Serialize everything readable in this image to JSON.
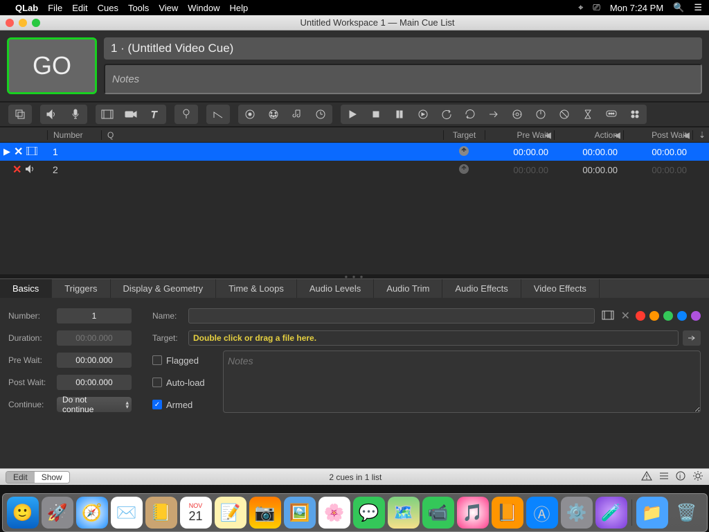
{
  "menubar": {
    "app": "QLab",
    "items": [
      "File",
      "Edit",
      "Cues",
      "Tools",
      "View",
      "Window",
      "Help"
    ],
    "clock": "Mon 7:24 PM"
  },
  "window": {
    "title": "Untitled Workspace 1 — Main Cue List"
  },
  "header": {
    "go": "GO",
    "cue_title": "1 · (Untitled Video Cue)",
    "notes_placeholder": "Notes"
  },
  "columns": {
    "number": "Number",
    "q": "Q",
    "target": "Target",
    "prewait": "Pre Wait",
    "action": "Action",
    "postwait": "Post Wait"
  },
  "cues": [
    {
      "num": "1",
      "type": "video",
      "prewait": "00:00.00",
      "action": "00:00.00",
      "postwait": "00:00.00",
      "selected": true,
      "broken": true
    },
    {
      "num": "2",
      "type": "audio",
      "prewait": "00:00.00",
      "action": "00:00.00",
      "postwait": "00:00.00",
      "selected": false,
      "broken": true,
      "dim_prewait": true,
      "dim_postwait": true
    }
  ],
  "tabs": [
    "Basics",
    "Triggers",
    "Display & Geometry",
    "Time & Loops",
    "Audio Levels",
    "Audio Trim",
    "Audio Effects",
    "Video Effects"
  ],
  "inspector": {
    "number_label": "Number:",
    "number_value": "1",
    "duration_label": "Duration:",
    "duration_value": "00:00.000",
    "prewait_label": "Pre Wait:",
    "prewait_value": "00:00.000",
    "postwait_label": "Post Wait:",
    "postwait_value": "00:00.000",
    "continue_label": "Continue:",
    "continue_value": "Do not continue",
    "name_label": "Name:",
    "name_value": "",
    "target_label": "Target:",
    "target_hint": "Double click or drag a file here.",
    "flagged": "Flagged",
    "autoload": "Auto-load",
    "armed": "Armed",
    "notes_placeholder": "Notes",
    "colors": [
      "#ff3b30",
      "#ff9500",
      "#34c759",
      "#0a84ff",
      "#af52de"
    ]
  },
  "footer": {
    "edit": "Edit",
    "show": "Show",
    "status": "2 cues in 1 list"
  }
}
